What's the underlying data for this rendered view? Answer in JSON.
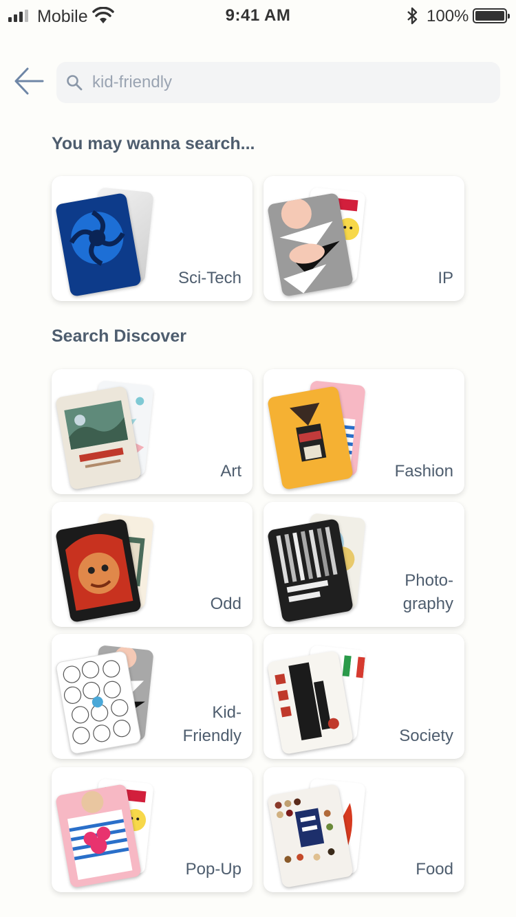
{
  "status_bar": {
    "carrier": "Mobile",
    "time": "9:41 AM",
    "battery": "100%"
  },
  "search": {
    "placeholder": "kid-friendly",
    "value": ""
  },
  "suggest": {
    "title": "You may wanna search...",
    "items": [
      {
        "label": "Sci-Tech",
        "icon": "scitech-poster-icon"
      },
      {
        "label": "IP",
        "icon": "ip-poster-icon"
      }
    ]
  },
  "discover": {
    "title": "Search Discover",
    "items": [
      {
        "label": "Art",
        "icon": "art-poster-icon"
      },
      {
        "label": "Fashion",
        "icon": "fashion-poster-icon"
      },
      {
        "label": "Odd",
        "icon": "odd-poster-icon"
      },
      {
        "label": "Photo-\ngraphy",
        "icon": "photography-poster-icon"
      },
      {
        "label": "Kid-\nFriendly",
        "icon": "kidfriendly-poster-icon"
      },
      {
        "label": "Society",
        "icon": "society-poster-icon"
      },
      {
        "label": "Pop-Up",
        "icon": "popup-poster-icon"
      },
      {
        "label": "Food",
        "icon": "food-poster-icon"
      }
    ]
  },
  "colors": {
    "background": "#fdfdfa",
    "text": "#4e5d6e",
    "search_bg": "#f3f4f5",
    "accent": "#6e86a6"
  }
}
